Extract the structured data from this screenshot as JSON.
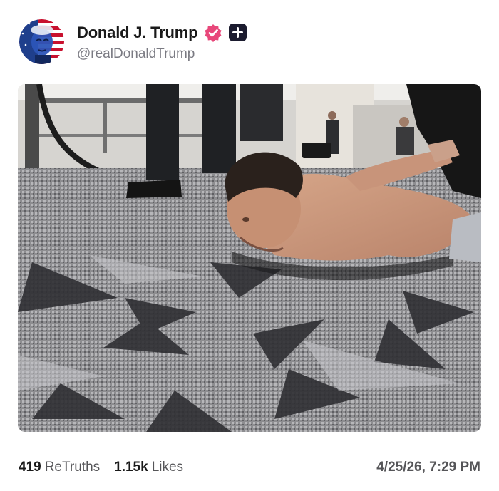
{
  "post": {
    "author": {
      "display_name": "Donald J. Trump",
      "handle": "@realDonaldTrump",
      "avatar_icon": "flag-portrait-avatar",
      "verified_icon": "verified-badge-icon",
      "follow_icon": "plus-icon"
    },
    "media": {
      "icon": "photo-image"
    },
    "stats": {
      "retruths_count": "419",
      "retruths_label": "ReTruths",
      "likes_count": "1.15k",
      "likes_label": "Likes"
    },
    "timestamp": "4/25/26, 7:29 PM"
  },
  "colors": {
    "verified": "#e8477a",
    "follow_button": "#1b1b2f",
    "text_primary": "#1a1a1a",
    "text_secondary": "#7a7a82"
  }
}
